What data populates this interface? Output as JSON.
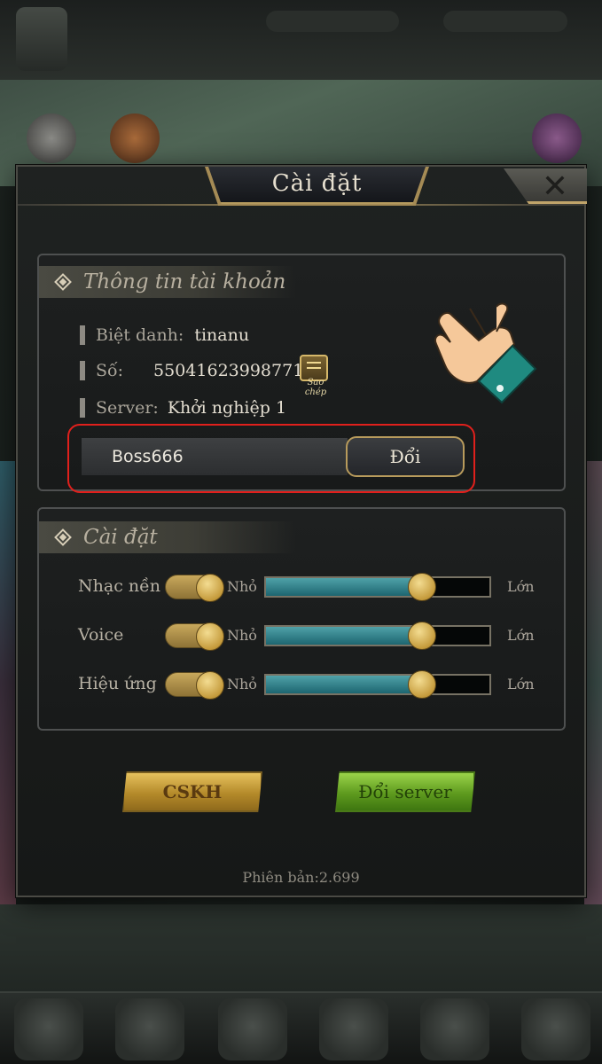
{
  "dialog": {
    "title": "Cài đặt"
  },
  "account": {
    "section_title": "Thông tin tài khoản",
    "nickname_label": "Biệt danh:",
    "nickname_value": "tinanu",
    "id_label": "Số:",
    "id_value": "550416239987712",
    "copy_label": "Sao chép",
    "server_label": "Server:",
    "server_value": "Khởi nghiệp 1",
    "rename_value": "Boss666",
    "rename_button": "Đổi"
  },
  "settings": {
    "section_title": "Cài đặt",
    "min_label": "Nhỏ",
    "max_label": "Lớn",
    "rows": [
      {
        "label": "Nhạc nền",
        "enabled": true,
        "level": 0.7
      },
      {
        "label": "Voice",
        "enabled": true,
        "level": 0.7
      },
      {
        "label": "Hiệu ứng",
        "enabled": true,
        "level": 0.7
      }
    ]
  },
  "buttons": {
    "support": "CSKH",
    "change_server": "Đổi server"
  },
  "version": "Phiên bản:2.699",
  "colors": {
    "highlight": "#e0201c",
    "gold": "#c59b3c",
    "teal": "#2f8a94",
    "green_button": "#6aa82a",
    "gold_button": "#c9a040"
  },
  "icons": {
    "close": "close-icon",
    "section": "diamond-icon",
    "copy": "copy-icon",
    "hand": "pointing-hand-icon"
  }
}
